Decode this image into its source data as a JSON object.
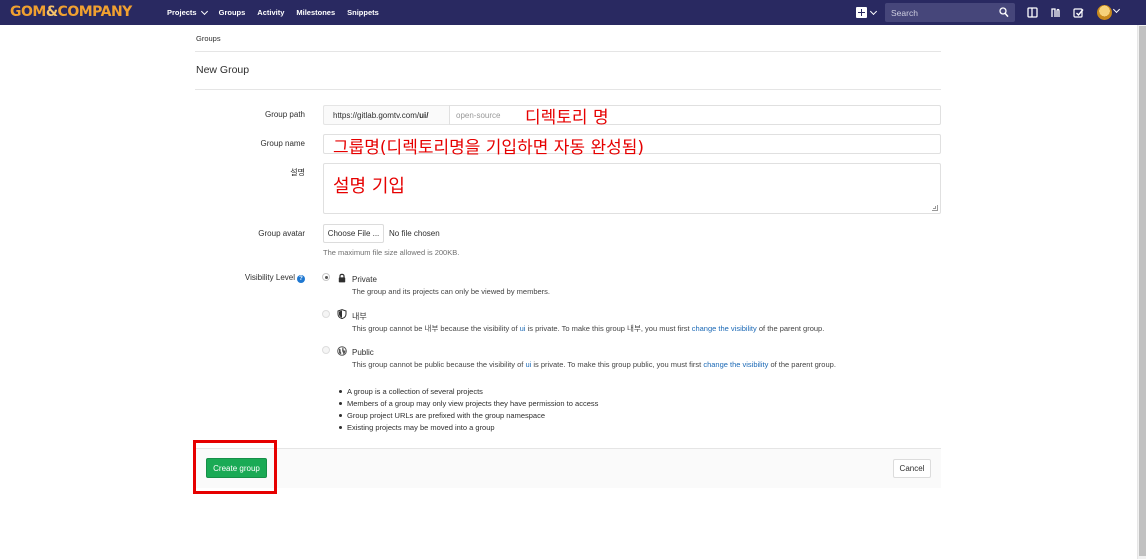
{
  "brand": {
    "logo_main": "GOM",
    "logo_amp": "&",
    "logo_rest": "COMPANY"
  },
  "navbar": {
    "links": [
      "Projects",
      "Groups",
      "Activity",
      "Milestones",
      "Snippets"
    ],
    "search_placeholder": "Search"
  },
  "breadcrumb": "Groups",
  "page_title": "New Group",
  "form": {
    "group_path_label": "Group path",
    "path_prefix_start": "https://gitlab.gomtv.com/",
    "path_prefix_bold": "ui/",
    "path_placeholder": "open-source",
    "path_annotation": "디렉토리 명",
    "group_name_label": "Group name",
    "group_name_annotation": "그룹명(디렉토리명을 기입하면 자동 완성됨)",
    "description_label": "설명",
    "description_annotation": "설명 기입",
    "avatar_label": "Group avatar",
    "choose_file": "Choose File ...",
    "no_file": "No file chosen",
    "avatar_help": "The maximum file size allowed is 200KB.",
    "visibility_label": "Visibility Level",
    "visibility": [
      {
        "title": "Private",
        "desc": "The group and its projects can only be viewed by members.",
        "checked": true
      },
      {
        "title": "내부",
        "desc_pre": "This group cannot be 내부 because the visibility of ",
        "desc_link1": "ui",
        "desc_mid": " is private. To make this group 내부, you must first ",
        "desc_link2": "change the visibility",
        "desc_post": " of the parent group.",
        "checked": false
      },
      {
        "title": "Public",
        "desc_pre": "This group cannot be public because the visibility of ",
        "desc_link1": "ui",
        "desc_mid": " is private. To make this group public, you must first ",
        "desc_link2": "change the visibility",
        "desc_post": " of the parent group.",
        "checked": false
      }
    ],
    "notes": [
      "A group is a collection of several projects",
      "Members of a group may only view projects they have permission to access",
      "Group project URLs are prefixed with the group namespace",
      "Existing projects may be moved into a group"
    ],
    "create_button": "Create group",
    "cancel_button": "Cancel"
  },
  "colors": {
    "navbar": "#292961",
    "brand_orange": "#f0a030",
    "create_green": "#1aaa55",
    "annotation_red": "#e60000",
    "link_blue": "#1b69b6"
  },
  "icons": [
    "plus-square-icon",
    "search-icon",
    "sidebar-panel-icon",
    "merge-request-icon",
    "todo-check-icon",
    "user-avatar",
    "lock-icon",
    "shield-icon",
    "globe-icon",
    "help-icon"
  ]
}
